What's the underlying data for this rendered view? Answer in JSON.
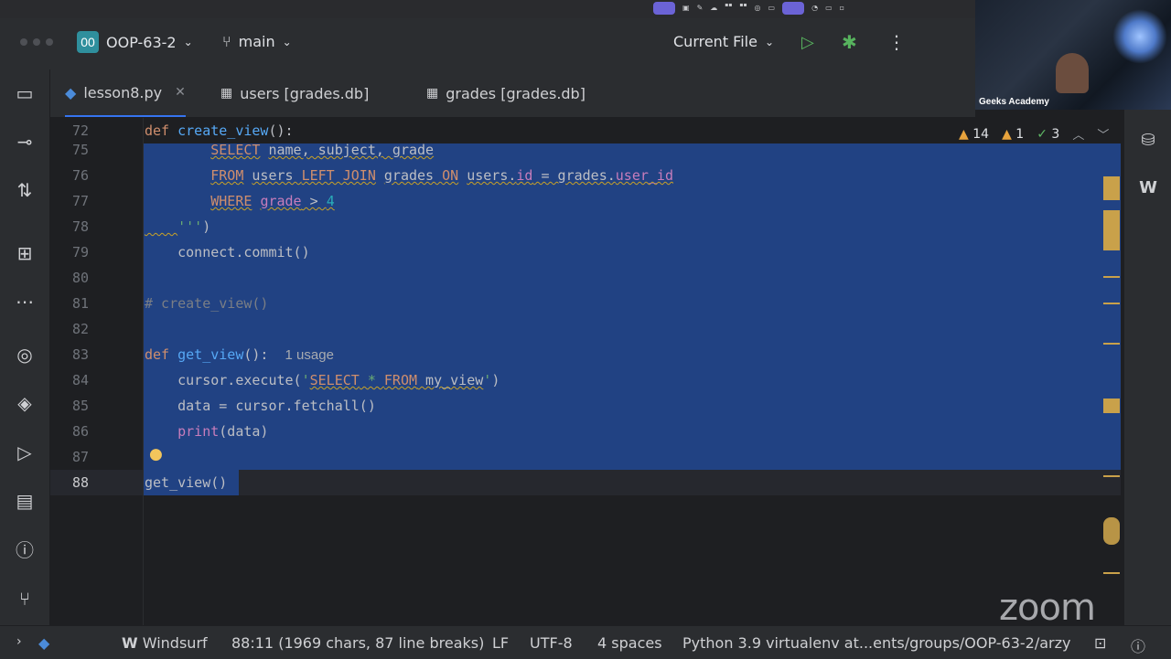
{
  "webcam": {
    "name": "Geeks Academy"
  },
  "toolbar": {
    "project_badge": "00",
    "project_name": "OOP-63-2",
    "branch": "main",
    "run_config": "Current File"
  },
  "tabs": [
    {
      "label": "lesson8.py",
      "active": true
    },
    {
      "label": "users [grades.db]"
    },
    {
      "label": "grades [grades.db]"
    }
  ],
  "inspections": {
    "warnings": "14",
    "weak_warnings": "1",
    "ok": "3"
  },
  "editor": {
    "sticky_line": "72",
    "lines": [
      "72",
      "75",
      "76",
      "77",
      "78",
      "79",
      "80",
      "81",
      "82",
      "83",
      "84",
      "85",
      "86",
      "87",
      "88"
    ],
    "usage_hint": "1 usage"
  },
  "statusbar": {
    "plugin": "Windsurf",
    "position": "88:11 (1969 chars, 87 line breaks)",
    "line_sep": "LF",
    "encoding": "UTF-8",
    "indent": "4 spaces",
    "interpreter": "Python 3.9 virtualenv at...ents/groups/OOP-63-2/arzy"
  },
  "overlay": {
    "zoom_logo": "zoom"
  },
  "icons": [
    "folder-icon",
    "commit-icon",
    "pull-request-icon",
    "structure-icon",
    "more-icon",
    "python-console-icon",
    "layers-icon",
    "run-icon",
    "terminal-icon",
    "problems-icon",
    "git-icon",
    "database-icon",
    "windsurf-icon",
    "lightbulb-icon"
  ]
}
